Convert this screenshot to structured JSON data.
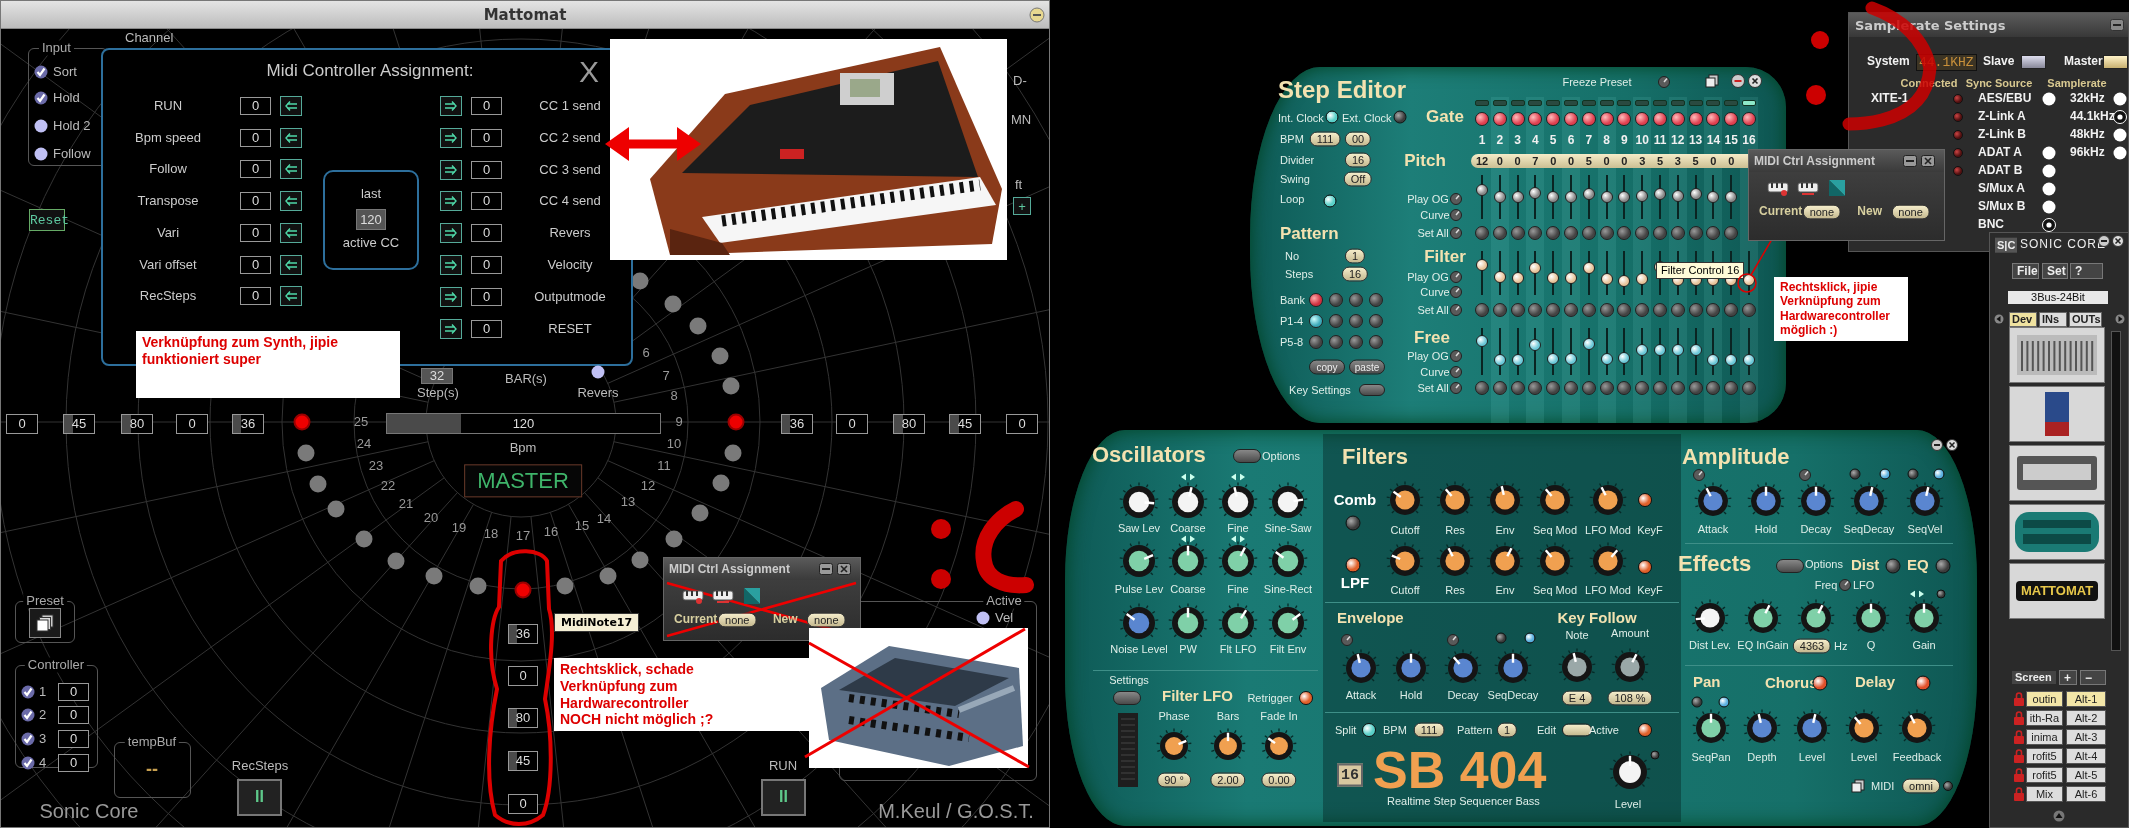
{
  "mattomat": {
    "title": "Mattomat",
    "input": {
      "label": "Input",
      "options": [
        {
          "label": "Sort",
          "checked": true
        },
        {
          "label": "Hold",
          "checked": true
        },
        {
          "label": "Hold 2",
          "checked": false
        },
        {
          "label": "Follow",
          "checked": false
        }
      ]
    },
    "channel_label": "Channel",
    "reset": "Reset",
    "edge_labels": [
      "D-",
      "MN",
      "ft"
    ],
    "edge_button": "+",
    "dialog": {
      "title": "Midi Controller Assignment:",
      "close": "X",
      "inputs": [
        {
          "label": "RUN",
          "value": "0"
        },
        {
          "label": "Bpm speed",
          "value": "0"
        },
        {
          "label": "Follow",
          "value": "0"
        },
        {
          "label": "Transpose",
          "value": "0"
        },
        {
          "label": "Vari",
          "value": "0"
        },
        {
          "label": "Vari offset",
          "value": "0"
        },
        {
          "label": "RecSteps",
          "value": "0"
        }
      ],
      "outputs": [
        {
          "label": "CC 1 send",
          "value": "0"
        },
        {
          "label": "CC 2 send",
          "value": "0"
        },
        {
          "label": "CC 3 send",
          "value": "0"
        },
        {
          "label": "CC 4 send",
          "value": "0"
        },
        {
          "label": "Revers",
          "value": "0"
        },
        {
          "label": "Velocity",
          "value": "0"
        },
        {
          "label": "Outputmode",
          "value": "0"
        },
        {
          "label": "RESET",
          "value": "0"
        }
      ],
      "last": {
        "label": "last",
        "value": "120",
        "caption": "active CC"
      }
    },
    "annotation": "Verknüpfung zum Synth, jipie\nfunktioniert super",
    "steps": {
      "value": "32",
      "label": "Step(s)"
    },
    "bars_label": "BAR(s)",
    "revers": {
      "label": "Revers",
      "checked": false
    },
    "left_values": [
      {
        "value": "0"
      },
      {
        "value": "45",
        "level": 0.3
      },
      {
        "value": "80",
        "level": 0.3
      },
      {
        "value": "0"
      },
      {
        "value": "36",
        "level": 0.25
      }
    ],
    "bpm": {
      "value": "120",
      "level": 0.27,
      "label": "Bpm"
    },
    "right_values": [
      {
        "value": "36",
        "level": 0.25
      },
      {
        "value": "0"
      },
      {
        "value": "80",
        "level": 0.3
      },
      {
        "value": "45",
        "level": 0.3
      },
      {
        "value": "0"
      }
    ],
    "ring": [
      {
        "active": false
      },
      {
        "active": false
      },
      {
        "label": "6",
        "active": false
      },
      {
        "label": "7",
        "active": false
      },
      {
        "label": "8",
        "active": false
      },
      {
        "label": "25",
        "active": true
      },
      {
        "label": "9",
        "active": true
      },
      {
        "label": "24",
        "active": false
      },
      {
        "label": "10",
        "active": false
      },
      {
        "label": "23",
        "active": false
      },
      {
        "label": "11",
        "active": false
      },
      {
        "label": "22",
        "active": false
      },
      {
        "label": "12",
        "active": false
      },
      {
        "label": "21",
        "active": false
      },
      {
        "label": "13",
        "active": false
      },
      {
        "label": "20",
        "active": false
      },
      {
        "label": "14",
        "active": false
      },
      {
        "label": "19",
        "active": false
      },
      {
        "label": "15",
        "active": false
      },
      {
        "label": "18",
        "active": false
      },
      {
        "label": "16",
        "active": false
      },
      {
        "label": "17",
        "active": true
      }
    ],
    "master": "MASTER",
    "tooltip": "MidiNote17",
    "column_values": [
      {
        "value": "36",
        "level": 0.3
      },
      {
        "value": "0"
      },
      {
        "value": "80",
        "level": 0.3
      },
      {
        "value": "45",
        "level": 0.3
      },
      {
        "value": "0"
      }
    ],
    "preset": {
      "label": "Preset"
    },
    "controller": {
      "label": "Controller",
      "rows": [
        {
          "number": "1",
          "value": "0",
          "checked": true
        },
        {
          "number": "2",
          "value": "0",
          "checked": true
        },
        {
          "number": "3",
          "value": "0",
          "checked": true
        },
        {
          "number": "4",
          "value": "0",
          "checked": true
        }
      ]
    },
    "tempbuf": {
      "label": "tempBuf",
      "value": "--"
    },
    "recsteps": {
      "label": "RecSteps",
      "button": "II"
    },
    "run": {
      "label": "RUN",
      "button": "II"
    },
    "brand": "Sonic Core",
    "credit": "M.Keul / G.O.S.T.",
    "active": {
      "label": "Active",
      "options": [
        {
          "label": "Vel",
          "checked": false
        }
      ]
    },
    "midi_popup": {
      "title": "MIDI Ctrl Assignment",
      "current_label": "Current",
      "current": "none",
      "new_label": "New",
      "new": "none"
    },
    "annotation_hw": "Rechtsklick, schade\nVerknüpfung zum Hardwarecontroller\nNOCH nicht möglich ;?"
  },
  "step_editor": {
    "title": "Step Editor",
    "freeze": "Freeze Preset",
    "clock": [
      {
        "label": "Int. Clock",
        "selected": true
      },
      {
        "label": "Ext. Clock",
        "selected": false
      }
    ],
    "bpm": {
      "label": "BPM",
      "values": [
        "111",
        "00"
      ]
    },
    "divider": {
      "label": "Divider",
      "value": "16"
    },
    "swing": {
      "label": "Swing",
      "value": "Off"
    },
    "loop": {
      "label": "Loop",
      "on": true
    },
    "pattern": {
      "title": "Pattern",
      "no_label": "No",
      "no": "1",
      "steps_label": "Steps",
      "steps": "16"
    },
    "banks": [
      {
        "label": "Bank",
        "buttons": [
          {
            "selected": true
          },
          {
            "selected": false
          },
          {
            "selected": false
          },
          {
            "selected": false
          }
        ]
      },
      {
        "label": "P1-4",
        "buttons": [
          {
            "selected": true
          },
          {
            "selected": false
          },
          {
            "selected": false
          },
          {
            "selected": false
          }
        ]
      },
      {
        "label": "P5-8",
        "buttons": [
          {
            "selected": false
          },
          {
            "selected": false
          },
          {
            "selected": false
          },
          {
            "selected": false
          }
        ]
      }
    ],
    "copy": "copy",
    "paste": "paste",
    "key_settings": "Key Settings",
    "gate_label": "Gate",
    "gates": [
      {
        "on": true,
        "lit": false
      },
      {
        "on": true,
        "lit": false
      },
      {
        "on": true,
        "lit": false
      },
      {
        "on": true,
        "lit": false
      },
      {
        "on": true,
        "lit": false
      },
      {
        "on": true,
        "lit": false
      },
      {
        "on": true,
        "lit": false
      },
      {
        "on": true,
        "lit": false
      },
      {
        "on": true,
        "lit": false
      },
      {
        "on": true,
        "lit": false
      },
      {
        "on": true,
        "lit": false
      },
      {
        "on": true,
        "lit": false
      },
      {
        "on": true,
        "lit": false
      },
      {
        "on": true,
        "lit": false
      },
      {
        "on": true,
        "lit": false
      },
      {
        "on": true,
        "lit": true
      }
    ],
    "step_numbers": [
      "1",
      "2",
      "3",
      "4",
      "5",
      "6",
      "7",
      "8",
      "9",
      "10",
      "11",
      "12",
      "13",
      "14",
      "15",
      "16"
    ],
    "pitch_values": [
      "12",
      "0",
      "0",
      "7",
      "0",
      "0",
      "5",
      "0",
      "0",
      "3",
      "5",
      "3",
      "5",
      "0",
      "0"
    ],
    "lanes": [
      {
        "label": "Pitch",
        "play_og": "Play OG",
        "curve": "Curve",
        "set_all": "Set All",
        "sliders": [
          {
            "level": 0.72
          },
          {
            "level": 0.5
          },
          {
            "level": 0.5
          },
          {
            "level": 0.63
          },
          {
            "level": 0.5
          },
          {
            "level": 0.5
          },
          {
            "level": 0.59
          },
          {
            "level": 0.5
          },
          {
            "level": 0.5
          },
          {
            "level": 0.54
          },
          {
            "level": 0.59
          },
          {
            "level": 0.54
          },
          {
            "level": 0.59
          },
          {
            "level": 0.5
          },
          {
            "level": 0.5
          }
        ]
      },
      {
        "label": "Filter",
        "play_og": "Play OG",
        "curve": "Curve",
        "set_all": "Set All",
        "sliders": [
          {
            "level": 0.74
          },
          {
            "level": 0.36
          },
          {
            "level": 0.34
          },
          {
            "level": 0.66
          },
          {
            "level": 0.34
          },
          {
            "level": 0.34
          },
          {
            "level": 0.66
          },
          {
            "level": 0.32
          },
          {
            "level": 0.26
          },
          {
            "level": 0.32
          },
          {
            "level": 0.68
          },
          {
            "level": 0.29
          },
          {
            "level": 0.29
          },
          {
            "level": 0.29
          },
          {
            "level": 0.29
          },
          {
            "level": 0.29
          }
        ]
      },
      {
        "label": "Free",
        "play_og": "Play OG",
        "curve": "Curve",
        "set_all": "Set All",
        "sliders": [
          {
            "level": 0.8
          },
          {
            "level": 0.25
          },
          {
            "level": 0.25
          },
          {
            "level": 0.68
          },
          {
            "level": 0.28
          },
          {
            "level": 0.28
          },
          {
            "level": 0.72
          },
          {
            "level": 0.3
          },
          {
            "level": 0.32
          },
          {
            "level": 0.55
          },
          {
            "level": 0.55
          },
          {
            "level": 0.55
          },
          {
            "level": 0.55
          },
          {
            "level": 0.25
          },
          {
            "level": 0.25
          },
          {
            "level": 0.25
          }
        ]
      }
    ],
    "tooltip": "Filter Control 16",
    "annotation": "Rechtsklick, jipie\nVerknüpfung zum\nHardwarecontroller\nmöglich :)"
  },
  "midi_ctl": {
    "title": "MIDI Ctrl Assignment",
    "current_label": "Current",
    "current": "none",
    "new_label": "New",
    "new": "none"
  },
  "samplerate": {
    "title": "Samplerate Settings",
    "system_label": "System",
    "system_value": "44.1KHZ",
    "clock_modes": [
      {
        "label": "Slave",
        "selected": false
      },
      {
        "label": "Master",
        "selected": true
      }
    ],
    "headers": [
      "Connected",
      "Sync Source",
      "Samplerate"
    ],
    "device": "XITE-1",
    "sync_sources": [
      {
        "label": "AES/EBU",
        "kind": "radio",
        "selected": false
      },
      {
        "label": "Z-Link A",
        "kind": "plain",
        "selected": false
      },
      {
        "label": "Z-Link B",
        "kind": "plain",
        "selected": false
      },
      {
        "label": "ADAT A",
        "kind": "radio",
        "selected": false
      },
      {
        "label": "ADAT B",
        "kind": "radio",
        "selected": false
      },
      {
        "label": "S/Mux A",
        "kind": "radio",
        "selected": false
      },
      {
        "label": "S/Mux B",
        "kind": "radio",
        "selected": false
      },
      {
        "label": "BNC",
        "kind": "radio",
        "selected": true
      }
    ],
    "samplerates": [
      {
        "label": "32kHz",
        "selected": false
      },
      {
        "label": "44.1kHz",
        "selected": true
      },
      {
        "label": "48kHz",
        "selected": false
      },
      {
        "label": "96kHz",
        "selected": false
      }
    ]
  },
  "sonic_core": {
    "logo": "S|C",
    "brand": "SONIC CORE",
    "menu": [
      "File",
      "Set",
      "?"
    ],
    "preset": "3Bus-24Bit",
    "tabs": [
      {
        "label": "Dev",
        "selected": true
      },
      {
        "label": "INs",
        "selected": false
      },
      {
        "label": "OUTs",
        "selected": false
      }
    ],
    "devices": [
      {
        "kind": "mixer"
      },
      {
        "kind": "module"
      },
      {
        "kind": "dialog"
      },
      {
        "kind": "sequencer"
      },
      {
        "kind": "logo",
        "label": "MATTOMAT"
      }
    ],
    "screens": {
      "label": "Screen",
      "add": "+",
      "remove": "−",
      "items": [
        {
          "name": "outin",
          "key": "Alt-1",
          "selected": true
        },
        {
          "name": "ith-Ra",
          "key": "Alt-2",
          "selected": false
        },
        {
          "name": "inima",
          "key": "Alt-3",
          "selected": false
        },
        {
          "name": "rofit5",
          "key": "Alt-4",
          "selected": false
        },
        {
          "name": "rofit5",
          "key": "Alt-5",
          "selected": false
        },
        {
          "name": "Mix",
          "key": "Alt-6",
          "selected": false
        }
      ]
    }
  },
  "sb404": {
    "oscillators": {
      "title": "Oscillators",
      "options": "Options",
      "knobs": [
        {
          "label": "Saw Lev",
          "level": 0.85,
          "color": "#f4f4f4"
        },
        {
          "label": "Coarse",
          "level": 0.55,
          "color": "#f4f4f4"
        },
        {
          "label": "Fine",
          "level": 0.45,
          "color": "#f4f4f4"
        },
        {
          "label": "Sine-Saw",
          "level": 0.8,
          "color": "#f4f4f4"
        },
        {
          "label": "Pulse Lev",
          "level": 0.75,
          "color": "#7fd0a8"
        },
        {
          "label": "Coarse",
          "level": 0.5,
          "color": "#7fd0a8"
        },
        {
          "label": "Fine",
          "level": 0.6,
          "color": "#7fd0a8"
        },
        {
          "label": "Sine-Rect",
          "level": 0.3,
          "color": "#7fd0a8"
        },
        {
          "label": "Noise Level",
          "level": 0.3,
          "color": "#5a86d0"
        },
        {
          "label": "PW",
          "level": 0.5,
          "color": "#7fd0a8"
        },
        {
          "label": "Flt LFO",
          "level": 0.62,
          "color": "#7fd0a8"
        },
        {
          "label": "Filt Env",
          "level": 0.7,
          "color": "#7fd0a8"
        }
      ]
    },
    "filter_lfo": {
      "settings": "Settings",
      "title": "Filter LFO",
      "retrigger": "Retrigger",
      "retrigger_on": true,
      "knobs": [
        {
          "label": "Phase",
          "value": "90 °",
          "level": 0.75,
          "color": "#f0a050"
        },
        {
          "label": "Bars",
          "value": "2.00",
          "level": 0.5,
          "color": "#f0a050"
        },
        {
          "label": "Fade In",
          "value": "0.00",
          "level": 0.3,
          "color": "#f0a050"
        }
      ]
    },
    "filters": {
      "title": "Filters",
      "rows": [
        {
          "label": "Comb",
          "on": false,
          "keyf": "KeyF",
          "keyf_on": true,
          "knobs": [
            {
              "label": "Cutoff",
              "level": 0.3,
              "color": "#f0a050"
            },
            {
              "label": "Res",
              "level": 0.35,
              "color": "#f0a050"
            },
            {
              "label": "Env",
              "level": 0.45,
              "color": "#f0a050"
            },
            {
              "label": "Seq Mod",
              "level": 0.35,
              "color": "#f0a050"
            },
            {
              "label": "LFO Mod",
              "level": 0.4,
              "color": "#f0a050"
            }
          ]
        },
        {
          "label": "LPF",
          "on": true,
          "keyf": "KeyF",
          "keyf_on": true,
          "knobs": [
            {
              "label": "Cutoff",
              "level": 0.25,
              "color": "#f0a050"
            },
            {
              "label": "Res",
              "level": 0.4,
              "color": "#f0a050"
            },
            {
              "label": "Env",
              "level": 0.6,
              "color": "#f0a050"
            },
            {
              "label": "Seq Mod",
              "level": 0.35,
              "color": "#f0a050"
            },
            {
              "label": "LFO Mod",
              "level": 0.65,
              "color": "#f0a050"
            }
          ]
        }
      ]
    },
    "envelope": {
      "title": "Envelope",
      "knobs": [
        {
          "label": "Attack",
          "level": 0.45,
          "color": "#5a86d0"
        },
        {
          "label": "Hold",
          "level": 0.5,
          "color": "#5a86d0"
        },
        {
          "label": "Decay",
          "level": 0.35,
          "color": "#5a86d0"
        },
        {
          "label": "SeqDecay",
          "level": 0.5,
          "color": "#5a86d0"
        }
      ]
    },
    "key_follow": {
      "title": "Key Follow",
      "knobs": [
        {
          "label": "Note",
          "value": "E 4",
          "level": 0.45,
          "color": "#9aa8a8"
        },
        {
          "label": "Amount",
          "value": "108 %",
          "level": 0.6,
          "color": "#9aa8a8"
        }
      ]
    },
    "controls": {
      "split": "Split",
      "split_on": true,
      "bpm_label": "BPM",
      "bpm": "111",
      "pattern_label": "Pattern",
      "pattern": "1",
      "edit": "Edit",
      "active": "Active",
      "active_on": true
    },
    "logo": "16",
    "name": "SB 404",
    "subtitle": "Realtime Step Sequencer Bass",
    "level_knob": {
      "label": "Level",
      "level": 0.5,
      "color": "#f4f4f4"
    },
    "amplitude": {
      "title": "Amplitude",
      "knobs": [
        {
          "label": "Attack",
          "level": 0.4,
          "color": "#5a86d0"
        },
        {
          "label": "Hold",
          "level": 0.5,
          "color": "#5a86d0"
        },
        {
          "label": "Decay",
          "level": 0.5,
          "color": "#5a86d0"
        },
        {
          "label": "SeqDecay",
          "level": 0.55,
          "color": "#5a86d0"
        },
        {
          "label": "SeqVel",
          "level": 0.55,
          "color": "#5a86d0"
        }
      ]
    },
    "effects": {
      "title": "Effects",
      "options": "Options",
      "dist": "Dist",
      "dist_on": false,
      "eq": "EQ",
      "eq_on": false,
      "freq": "Freq",
      "lfo": "LFO",
      "knobs": [
        {
          "label": "Dist Lev.",
          "level": 0.15,
          "color": "#f4f4f4"
        },
        {
          "label": "EQ InGain",
          "level": 0.6,
          "color": "#7fd0a8"
        },
        {
          "value": "4363",
          "unit": "Hz",
          "level": 0.6,
          "color": "#7fd0a8"
        },
        {
          "label": "Q",
          "level": 0.5,
          "color": "#7fd0a8"
        },
        {
          "label": "Gain",
          "level": 0.5,
          "color": "#7fd0a8"
        }
      ]
    },
    "pan": "Pan",
    "chorus": "Chorus",
    "chorus_on": true,
    "delay": "Delay",
    "delay_on": true,
    "mod_knobs": [
      {
        "label": "SeqPan",
        "level": 0.5,
        "color": "#7fd0a8"
      },
      {
        "label": "Depth",
        "level": 0.45,
        "color": "#5a86d0"
      },
      {
        "label": "Level",
        "level": 0.55,
        "color": "#5a86d0"
      },
      {
        "label": "Level",
        "level": 0.35,
        "color": "#f0a050"
      },
      {
        "label": "Feedback",
        "level": 0.4,
        "color": "#f0a050"
      }
    ],
    "midi": {
      "label": "MIDI",
      "value": "omni"
    }
  }
}
